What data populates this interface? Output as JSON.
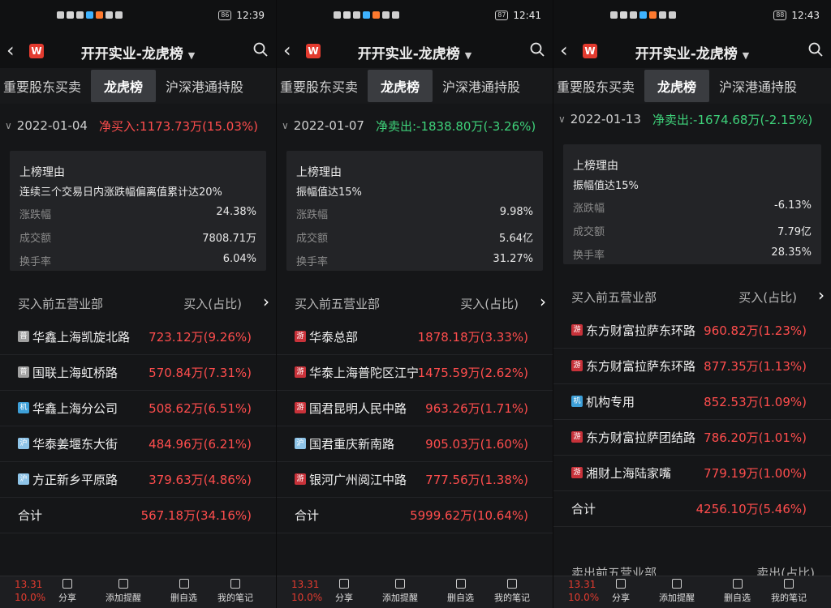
{
  "panels": [
    {
      "time": "12:39",
      "battery": "86",
      "title": "开开实业-龙虎榜",
      "tabs": [
        "重要股东买卖",
        "龙虎榜",
        "沪深港通持股"
      ],
      "date": "2022-01-04",
      "net_label": "净买入:1173.73万(15.03%)",
      "net_color": "red",
      "reason_label": "上榜理由",
      "reason": "连续三个交易日内涨跌幅偏离值累计达20%",
      "metrics": [
        {
          "label": "涨跌幅",
          "value": "24.38%",
          "color": "red"
        },
        {
          "label": "成交额",
          "value": "7808.71万",
          "color": "white"
        },
        {
          "label": "换手率",
          "value": "6.04%",
          "color": "white"
        }
      ],
      "section_left": "买入前五营业部",
      "section_right": "买入(占比)",
      "rows": [
        {
          "tag": "普",
          "tag_class": "p",
          "name": "华鑫上海凯旋北路",
          "value": "723.12万(9.26%)"
        },
        {
          "tag": "普",
          "tag_class": "p",
          "name": "国联上海虹桥路",
          "value": "570.84万(7.31%)"
        },
        {
          "tag": "机",
          "tag_class": "j",
          "name": "华鑫上海分公司",
          "value": "508.62万(6.51%)"
        },
        {
          "tag": "沪",
          "tag_class": "h",
          "name": "华泰姜堰东大街",
          "value": "484.96万(6.21%)"
        },
        {
          "tag": "沪",
          "tag_class": "h",
          "name": "方正新乡平原路",
          "value": "379.63万(4.86%)"
        }
      ],
      "total_label": "合计",
      "total_value": "567.18万(34.16%)",
      "price": "13.31",
      "pct": "10.0%",
      "footer": [
        "分享",
        "添加提醒",
        "删自选",
        "我的笔记"
      ]
    },
    {
      "time": "12:41",
      "battery": "87",
      "title": "开开实业-龙虎榜",
      "tabs": [
        "重要股东买卖",
        "龙虎榜",
        "沪深港通持股"
      ],
      "date": "2022-01-07",
      "net_label": "净卖出:-1838.80万(-3.26%)",
      "net_color": "green",
      "reason_label": "上榜理由",
      "reason": "振幅值达15%",
      "metrics": [
        {
          "label": "涨跌幅",
          "value": "9.98%",
          "color": "red"
        },
        {
          "label": "成交额",
          "value": "5.64亿",
          "color": "white"
        },
        {
          "label": "换手率",
          "value": "31.27%",
          "color": "white"
        }
      ],
      "section_left": "买入前五营业部",
      "section_right": "买入(占比)",
      "rows": [
        {
          "tag": "游",
          "tag_class": "y",
          "name": "华泰总部",
          "value": "1878.18万(3.33%)"
        },
        {
          "tag": "游",
          "tag_class": "y",
          "name": "华泰上海普陀区江宁",
          "value": "1475.59万(2.62%)"
        },
        {
          "tag": "游",
          "tag_class": "y",
          "name": "国君昆明人民中路",
          "value": "963.26万(1.71%)"
        },
        {
          "tag": "沪",
          "tag_class": "h",
          "name": "国君重庆新南路",
          "value": "905.03万(1.60%)"
        },
        {
          "tag": "游",
          "tag_class": "y",
          "name": "银河广州阅江中路",
          "value": "777.56万(1.38%)"
        }
      ],
      "total_label": "合计",
      "total_value": "5999.62万(10.64%)",
      "price": "13.31",
      "pct": "10.0%",
      "footer": [
        "分享",
        "添加提醒",
        "删自选",
        "我的笔记"
      ]
    },
    {
      "time": "12:43",
      "battery": "88",
      "title": "开开实业-龙虎榜",
      "tabs": [
        "重要股东买卖",
        "龙虎榜",
        "沪深港通持股"
      ],
      "date": "2022-01-13",
      "net_label": "净卖出:-1674.68万(-2.15%)",
      "net_color": "green",
      "reason_label": "上榜理由",
      "reason": "振幅值达15%",
      "metrics": [
        {
          "label": "涨跌幅",
          "value": "-6.13%",
          "color": "green"
        },
        {
          "label": "成交额",
          "value": "7.79亿",
          "color": "white"
        },
        {
          "label": "换手率",
          "value": "28.35%",
          "color": "white"
        }
      ],
      "section_left": "买入前五营业部",
      "section_right": "买入(占比)",
      "rows": [
        {
          "tag": "游",
          "tag_class": "y",
          "name": "东方财富拉萨东环路",
          "value": "960.82万(1.23%)"
        },
        {
          "tag": "游",
          "tag_class": "y",
          "name": "东方财富拉萨东环路",
          "value": "877.35万(1.13%)"
        },
        {
          "tag": "机",
          "tag_class": "j",
          "name": "机构专用",
          "value": "852.53万(1.09%)"
        },
        {
          "tag": "游",
          "tag_class": "y",
          "name": "东方财富拉萨团结路",
          "value": "786.20万(1.01%)"
        },
        {
          "tag": "游",
          "tag_class": "y",
          "name": "湘财上海陆家嘴",
          "value": "779.19万(1.00%)"
        }
      ],
      "total_label": "合计",
      "total_value": "4256.10万(5.46%)",
      "sell_left": "卖出前五营业部",
      "sell_right": "卖出(占比)",
      "price": "13.31",
      "pct": "10.0%",
      "footer": [
        "分享",
        "添加提醒",
        "删自选",
        "我的笔记"
      ]
    }
  ]
}
